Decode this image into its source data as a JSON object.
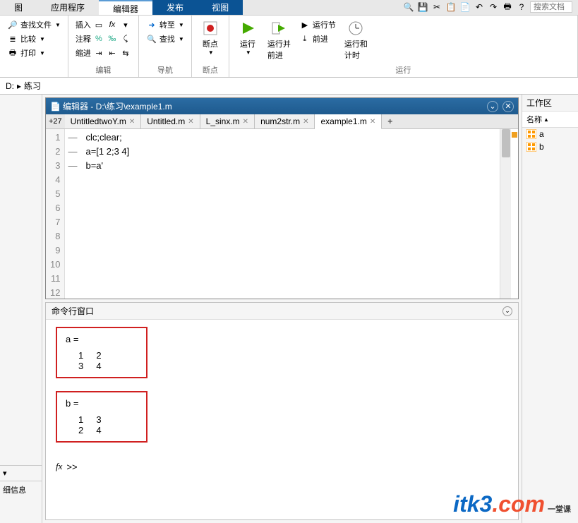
{
  "ribbon": {
    "tabs": [
      "图",
      "应用程序",
      "编辑器",
      "发布",
      "视图"
    ],
    "active_tab": 2,
    "search_placeholder": "搜索文档",
    "group_file": {
      "find_files": "查找文件",
      "compare": "比较",
      "print": "打印",
      "label": ""
    },
    "group_edit": {
      "insert": "插入",
      "comment": "注释",
      "indent": "缩进",
      "label": "编辑"
    },
    "group_nav": {
      "goto": "转至",
      "find": "查找",
      "label": "导航"
    },
    "group_bp": {
      "breakpoints": "断点",
      "label": "断点"
    },
    "group_run": {
      "run": "运行",
      "run_advance": "运行并\n前进",
      "run_section": "运行节",
      "advance": "前进",
      "run_time": "运行和\n计时",
      "label": "运行"
    }
  },
  "path_bar": {
    "drive": "D:",
    "folder": "练习"
  },
  "editor": {
    "title": "编辑器 - D:\\练习\\example1.m",
    "zoom": "+27",
    "tabs": [
      "UntitledtwoY.m",
      "Untitled.m",
      "L_sinx.m",
      "num2str.m",
      "example1.m"
    ],
    "active_tab": 4,
    "lines": [
      "clc;clear;",
      "a=[1 2;3 4]",
      "b=a'",
      "",
      "",
      "",
      "",
      "",
      "",
      "",
      "",
      ""
    ]
  },
  "command": {
    "title": "命令行窗口",
    "outputs": [
      {
        "var": "a =",
        "rows": [
          "     1     2",
          "     3     4"
        ]
      },
      {
        "var": "b =",
        "rows": [
          "     1     3",
          "     2     4"
        ]
      }
    ],
    "prompt": ">>"
  },
  "workspace": {
    "title": "工作区",
    "col_name": "名称",
    "vars": [
      "a",
      "b"
    ]
  },
  "details_label": "细信息",
  "watermark": {
    "brand": "itk3",
    "dotcom": ".com",
    "sub": "一堂课"
  }
}
